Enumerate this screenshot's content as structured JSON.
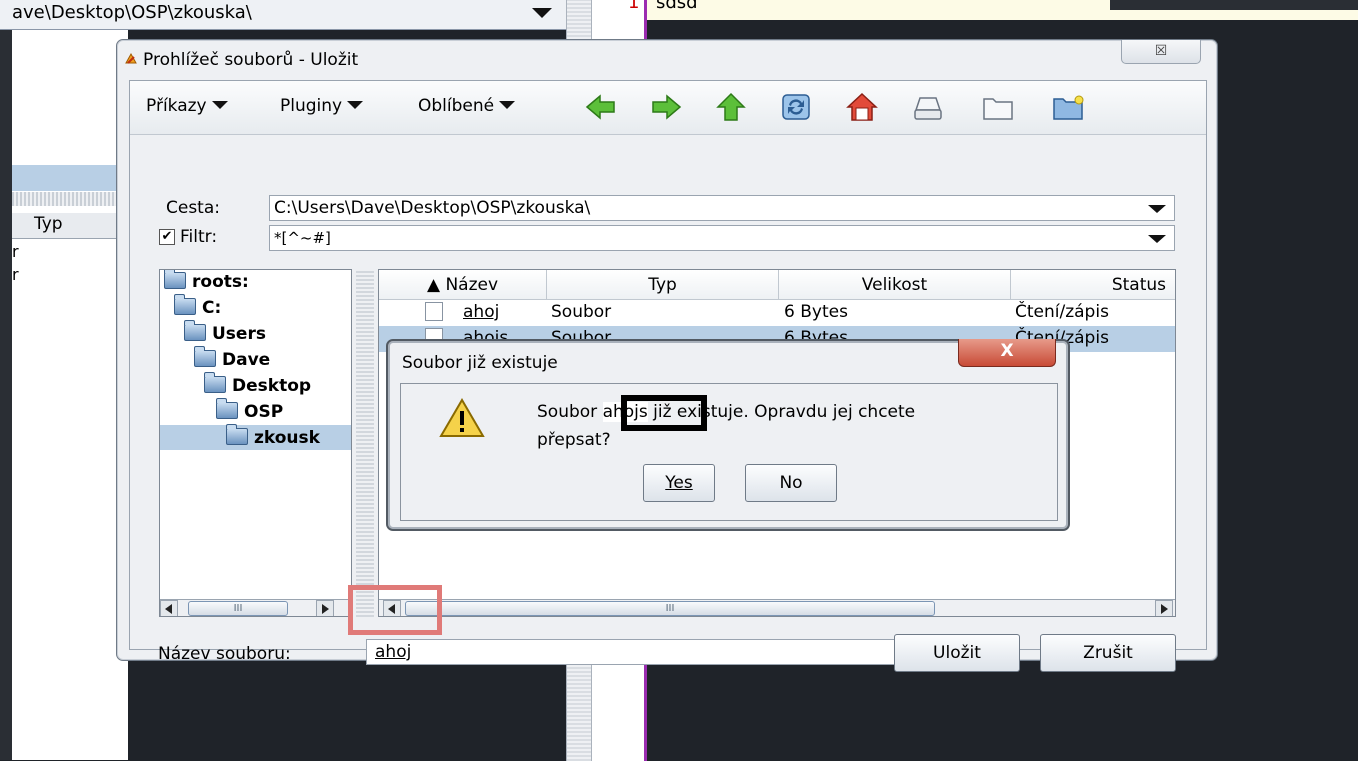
{
  "background": {
    "path": "ave\\Desktop\\OSP\\zkouska\\",
    "left_header": "Typ",
    "left_rows": [
      "r",
      "r"
    ],
    "editor_line_no": "1",
    "editor_text": "sdsd"
  },
  "dialog": {
    "title": "Prohlížeč souborů - Uložit",
    "close_glyph": "☒",
    "menus": [
      "Příkazy",
      "Pluginy",
      "Oblíbené"
    ],
    "path_label": "Cesta:",
    "path_value": "C:\\Users\\Dave\\Desktop\\OSP\\zkouska\\",
    "filter_label": "Filtr:",
    "filter_value": "*[^~#]",
    "filter_checked": "✔",
    "tree": [
      {
        "label": "roots:"
      },
      {
        "label": "C:"
      },
      {
        "label": "Users"
      },
      {
        "label": "Dave"
      },
      {
        "label": "Desktop"
      },
      {
        "label": "OSP"
      },
      {
        "label": "zkousk"
      }
    ],
    "columns": [
      "▲ Název",
      "Typ",
      "Velikost",
      "Status"
    ],
    "files": [
      {
        "name": "ahoj",
        "type": "Soubor",
        "size": "6 Bytes",
        "status": "Čtení/zápis"
      },
      {
        "name": "ahojs",
        "type": "Soubor",
        "size": "6 Bytes",
        "status": "Čtení/zápis"
      }
    ],
    "scroll_grip": "III",
    "filename_label": "Název souboru:",
    "filename_value": "ahoj",
    "save_label": "Uložit",
    "cancel_label": "Zrušit"
  },
  "confirm": {
    "title": "Soubor již existuje",
    "close_glyph": "X",
    "msg_prefix": "Soubor",
    "msg_name": "ahojs",
    "msg_suffix": "již existuje. Opravdu jej chcete",
    "msg_line2": "přepsat?",
    "yes_label": "Yes",
    "no_label": "No"
  },
  "colors": {
    "selection": "#b8cfe5",
    "highlight_box": "#e07a78",
    "close_red": "#c84b36"
  },
  "icons": [
    "back-arrow-icon",
    "forward-arrow-icon",
    "up-arrow-icon",
    "refresh-icon",
    "home-icon",
    "drive-icon",
    "folder-icon",
    "new-folder-icon",
    "warning-icon"
  ]
}
